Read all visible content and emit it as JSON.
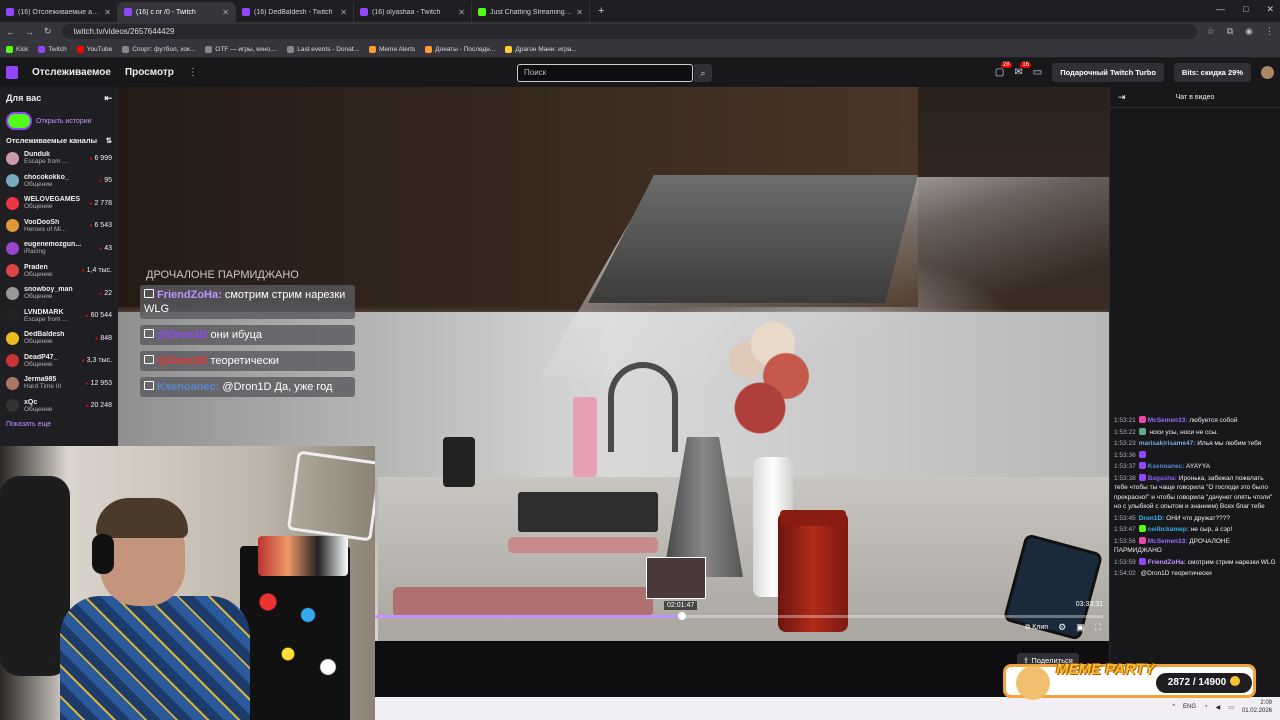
{
  "browser": {
    "tabs": [
      {
        "title": "(16) Отслеживаемые активны...",
        "active": false
      },
      {
        "title": "(16) с nr /0 - Twitch",
        "active": true
      },
      {
        "title": "(16) DedBaldesh - Twitch",
        "active": false
      },
      {
        "title": "(16) olyashaa - Twitch",
        "active": false
      },
      {
        "title": "Just Chatting Streaming - Live",
        "active": false
      }
    ],
    "url": "twitch.tv/videos/2657644429",
    "bookmarks": [
      "Kick",
      "Twitch",
      "YouTube",
      "Спорт: футбол, хок...",
      "OTF — игры, кино,...",
      "Last events - Donat...",
      "Meme Alerts",
      "Донаты - Последн...",
      "Драгон Мани: игра..."
    ]
  },
  "topnav": {
    "following": "Отслеживаемое",
    "browse": "Просмотр",
    "search_placeholder": "Поиск",
    "notif_count_1": "28",
    "notif_count_2": "16",
    "gift_turbo": "Подарочный Twitch Turbo",
    "bits": "Bits: скидка 29%"
  },
  "sidebar": {
    "title": "Для вас",
    "stories": "Открыть истории",
    "followed_title": "Отслеживаемые каналы",
    "channels": [
      {
        "name": "Dunduk",
        "game": "Escape from ...",
        "viewers": "6 999",
        "color": "#c9a"
      },
      {
        "name": "chocokokko_",
        "game": "Общение",
        "viewers": "95",
        "color": "#7ab"
      },
      {
        "name": "WELOVEGAMES",
        "game": "Общение",
        "viewers": "2 778",
        "color": "#e34"
      },
      {
        "name": "VooDooSh",
        "game": "Heroes of Mi...",
        "viewers": "6 543",
        "color": "#d93"
      },
      {
        "name": "eugenemozgun...",
        "game": "iRacing",
        "viewers": "43",
        "color": "#94c"
      },
      {
        "name": "Praden",
        "game": "Общение",
        "viewers": "1,4 тыс.",
        "color": "#d44"
      },
      {
        "name": "snowboy_man",
        "game": "Общение",
        "viewers": "22",
        "color": "#999"
      },
      {
        "name": "LVNDMARK",
        "game": "Escape from ...",
        "viewers": "60 544",
        "color": "#222"
      },
      {
        "name": "DedBaldesh",
        "game": "Общение",
        "viewers": "848",
        "color": "#eb2"
      },
      {
        "name": "DeadP47_",
        "game": "Общение",
        "viewers": "3,3 тыс.",
        "color": "#c33"
      },
      {
        "name": "Jerma985",
        "game": "Hard Time III",
        "viewers": "12 953",
        "color": "#a76"
      },
      {
        "name": "xQc",
        "game": "Общение",
        "viewers": "20 248",
        "color": "#333"
      }
    ],
    "show_more": "Показать еще"
  },
  "overlay": {
    "title": "ДРОЧАЛОНЕ ПАРМИДЖАНО",
    "messages": [
      {
        "user": "FriendZoHa:",
        "text": "смотрим стрим нарезки WLG",
        "color": "#bf94ff"
      },
      {
        "user": "@Dron1D",
        "text": "они ибуца",
        "color": "#9147ff"
      },
      {
        "user": "@Dron1D",
        "text": "теоретически",
        "color": "#e33"
      },
      {
        "user": "Ksenoanec:",
        "text": "@Dron1D Да, уже год",
        "color": "#58c"
      }
    ]
  },
  "player": {
    "hover_time": "02:01:47",
    "duration": "03:33:31",
    "progress_fraction": 0.422,
    "clip": "Клип"
  },
  "below": {
    "share": "Поделиться"
  },
  "chat": {
    "header": "Чат в видео",
    "messages": [
      {
        "ts": "1:53:21",
        "user": "McSemen33:",
        "text": "любуется собой",
        "color": "#9b6bff",
        "badge": "#e4a"
      },
      {
        "ts": "1:53:22",
        "user": "",
        "text": "носи усы, носи не ссы.",
        "color": "#e33",
        "badge": "#6a8"
      },
      {
        "ts": "1:53:23",
        "user": "marisakirisame47:",
        "text": "Илья мы любим тебя",
        "color": "#7ad",
        "badge": ""
      },
      {
        "ts": "1:53:36",
        "user": "",
        "text": "",
        "color": "#e33",
        "badge": "#9147ff"
      },
      {
        "ts": "1:53:37",
        "user": "Ksenoanec:",
        "text": "AYAYYA",
        "color": "#58c",
        "badge": "#9147ff"
      },
      {
        "ts": "1:53:38",
        "user": "Bagasha:",
        "text": "Иронька, забежал пожелать тебе чтобы ты чаще говорила \"О господи это было прекрасно!\" и чтобы говорила \"дачунет опять чтоли\" но с улыбкой с опытом и знанием) Всех благ тебе",
        "color": "#8a5cf6",
        "badge": "#9147ff"
      },
      {
        "ts": "1:53:45",
        "user": "Dron1D:",
        "text": "ОНИ что дружат????",
        "color": "#3bf",
        "badge": ""
      },
      {
        "ts": "1:53:47",
        "user": "ceilbckamep:",
        "text": "не сыр, а сэр!",
        "color": "#3ae",
        "badge": "#53fc18"
      },
      {
        "ts": "1:53:56",
        "user": "McSemen33:",
        "text": "ДРОЧАЛОНЕ ПАРМИДЖАНО",
        "color": "#9b6bff",
        "badge": "#e4a"
      },
      {
        "ts": "1:53:59",
        "user": "FriendZoHa:",
        "text": "смотрим стрим нарезки WLG",
        "color": "#bf94ff",
        "badge": "#9147ff"
      },
      {
        "ts": "1:54:02",
        "user": "",
        "text": "@Dron1D теоретически",
        "color": "#e33",
        "badge": ""
      }
    ]
  },
  "meme_widget": {
    "title": "MEME PARTY",
    "progress": "2872 / 14900"
  },
  "taskbar": {
    "lang": "ENG",
    "time": "2:09",
    "date": "01.02.2026"
  }
}
